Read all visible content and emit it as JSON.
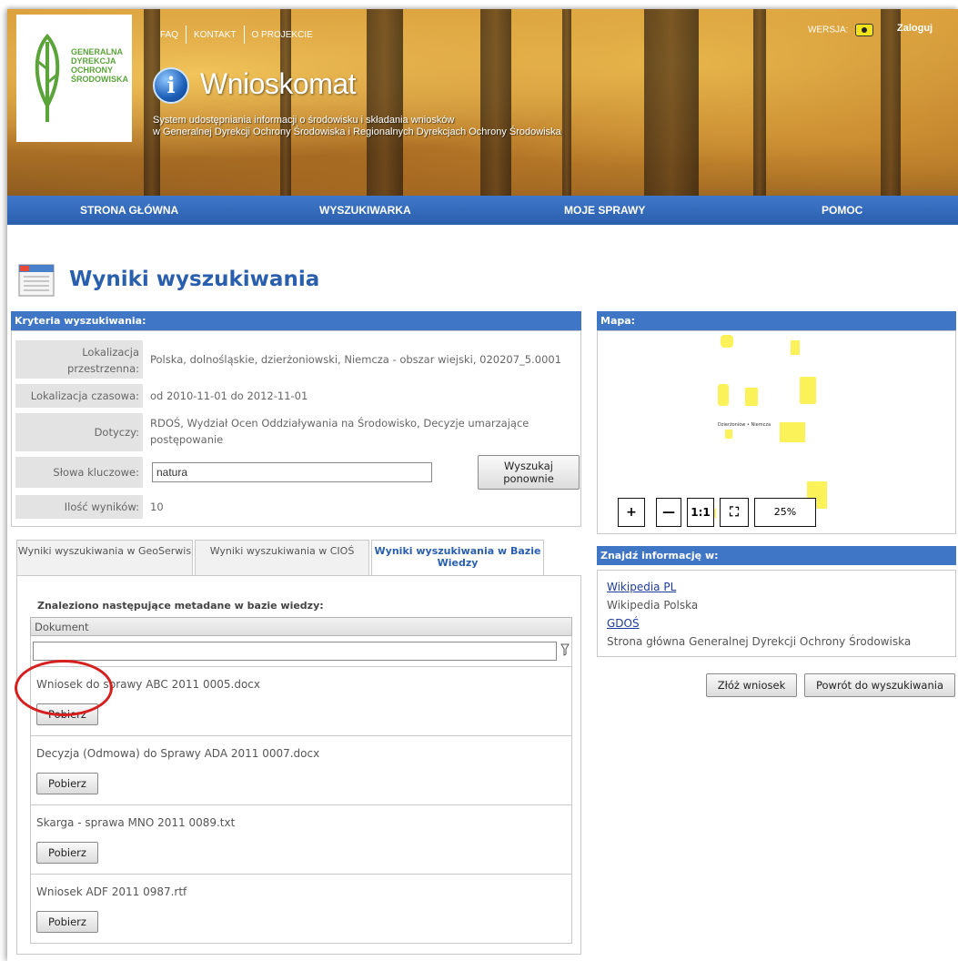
{
  "header": {
    "logo_text": "GENERALNA DYREKCJA OCHRONY ŚRODOWISKA",
    "top_links": [
      "FAQ",
      "KONTAKT",
      "O PROJEKCIE"
    ],
    "app_icon": "info-icon",
    "app_title": "Wnioskomat",
    "subtitle_line1": "System udostępniania informacji o środowisku i składania wniosków",
    "subtitle_line2": "w Generalnej Dyrekcji Ochrony Środowiska i Regionalnych Dyrekcjach Ochrony Środowiska",
    "version_label": "WERSJA:",
    "login": "Zaloguj"
  },
  "nav": {
    "items": [
      "STRONA GŁÓWNA",
      "WYSZUKIWARKA",
      "MOJE SPRAWY",
      "POMOC"
    ],
    "color": "#3b71c1"
  },
  "page_title": "Wyniki wyszukiwania",
  "criteria": {
    "heading": "Kryteria wyszukiwania:",
    "rows": [
      {
        "label": "Lokalizacja przestrzenna:",
        "value": "Polska, dolnośląskie, dzierżoniowski, Niemcza - obszar wiejski, 020207_5.0001"
      },
      {
        "label": "Lokalizacja czasowa:",
        "value": "od 2010-11-01 do 2012-11-01"
      },
      {
        "label": "Dotyczy:",
        "value": "RDOŚ, Wydział Ocen Oddziaływania na Środowisko, Decyzje umarzające postępowanie"
      },
      {
        "label": "Słowa kluczowe:",
        "value": "natura"
      },
      {
        "label": "Ilość wyników:",
        "value": "10"
      }
    ],
    "search_again": "Wyszukaj ponownie"
  },
  "map": {
    "heading": "Mapa:",
    "controls": [
      "+",
      "—",
      "1:1",
      "⛶"
    ],
    "zoom": "25%",
    "marker_label": "Dzierżoniów • Niemcza"
  },
  "tabs": [
    {
      "label": "Wyniki wyszukiwania w GeoSerwis",
      "active": false
    },
    {
      "label": "Wyniki wyszukiwania w CIOŚ",
      "active": false
    },
    {
      "label": "Wyniki wyszukiwania w Bazie Wiedzy",
      "active": true
    }
  ],
  "results": {
    "found_label": "Znaleziono następujące metadane w bazie wiedzy:",
    "column": "Dokument",
    "filter_value": "",
    "download_label": "Pobierz",
    "documents": [
      "Wniosek do sprawy ABC 2011 0005.docx",
      "Decyzja (Odmowa) do Sprawy ADA 2011 0007.docx",
      "Skarga - sprawa MNO 2011 0089.txt",
      "Wniosek ADF 2011 0987.rtf"
    ]
  },
  "find_info": {
    "heading": "Znajdź informację w:",
    "links": [
      {
        "link": "Wikipedia PL",
        "desc": "Wikipedia Polska"
      },
      {
        "link": "GDOŚ",
        "desc": "Strona główna Generalnej Dyrekcji Ochrony Środowiska"
      }
    ]
  },
  "actions": {
    "submit": "Złóż wniosek",
    "back": "Powrót do wyszukiwania"
  },
  "colors": {
    "accent": "#3f76c5",
    "title": "#2a5fae",
    "highlight": "#d61f1f",
    "map_blob": "#fbf25a"
  }
}
